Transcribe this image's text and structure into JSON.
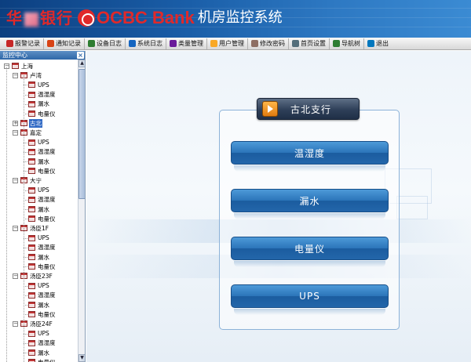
{
  "header": {
    "brand_cn": "华 银行",
    "brand_en": "OCBC Bank",
    "title": "机房监控系统"
  },
  "toolbar": {
    "items": [
      {
        "label": "报警记录",
        "icon": "alarm-icon",
        "color": "#c62828"
      },
      {
        "label": "通知记录",
        "icon": "notify-icon",
        "color": "#d84315"
      },
      {
        "label": "设备日志",
        "icon": "device-log-icon",
        "color": "#2e7d32"
      },
      {
        "label": "系统日志",
        "icon": "system-log-icon",
        "color": "#1565c0"
      },
      {
        "label": "类量管理",
        "icon": "settings-icon",
        "color": "#6a1b9a"
      },
      {
        "label": "用户管理",
        "icon": "user-icon",
        "color": "#f9a825"
      },
      {
        "label": "修改密码",
        "icon": "key-icon",
        "color": "#8d6e63"
      },
      {
        "label": "首页设置",
        "icon": "tools-icon",
        "color": "#546e7a"
      },
      {
        "label": "导航树",
        "icon": "tree-icon",
        "color": "#2e7d32"
      },
      {
        "label": "退出",
        "icon": "exit-icon",
        "color": "#0277bd"
      }
    ]
  },
  "sidebar": {
    "title": "监控中心",
    "close": "×",
    "tree": [
      {
        "label": "上海",
        "level": 0,
        "expander": "−"
      },
      {
        "label": "卢湾",
        "level": 1,
        "expander": "−"
      },
      {
        "label": "UPS",
        "level": 2
      },
      {
        "label": "温湿度",
        "level": 2
      },
      {
        "label": "漏水",
        "level": 2
      },
      {
        "label": "电量仪",
        "level": 2
      },
      {
        "label": "古北",
        "level": 1,
        "expander": "+",
        "selected": true
      },
      {
        "label": "嘉定",
        "level": 1,
        "expander": "−"
      },
      {
        "label": "UPS",
        "level": 2
      },
      {
        "label": "温湿度",
        "level": 2
      },
      {
        "label": "漏水",
        "level": 2
      },
      {
        "label": "电量仪",
        "level": 2
      },
      {
        "label": "大宁",
        "level": 1,
        "expander": "−"
      },
      {
        "label": "UPS",
        "level": 2
      },
      {
        "label": "温湿度",
        "level": 2
      },
      {
        "label": "漏水",
        "level": 2
      },
      {
        "label": "电量仪",
        "level": 2
      },
      {
        "label": "汤臣1F",
        "level": 1,
        "expander": "−"
      },
      {
        "label": "UPS",
        "level": 2
      },
      {
        "label": "温湿度",
        "level": 2
      },
      {
        "label": "漏水",
        "level": 2
      },
      {
        "label": "电量仪",
        "level": 2
      },
      {
        "label": "汤臣23F",
        "level": 1,
        "expander": "−"
      },
      {
        "label": "UPS",
        "level": 2
      },
      {
        "label": "温湿度",
        "level": 2
      },
      {
        "label": "漏水",
        "level": 2
      },
      {
        "label": "电量仪",
        "level": 2
      },
      {
        "label": "汤臣24F",
        "level": 1,
        "expander": "−"
      },
      {
        "label": "UPS",
        "level": 2
      },
      {
        "label": "温湿度",
        "level": 2
      },
      {
        "label": "漏水",
        "level": 2
      },
      {
        "label": "电量仪",
        "level": 2
      }
    ]
  },
  "main": {
    "panel_title": "古北支行",
    "buttons": [
      {
        "label": "温湿度"
      },
      {
        "label": "漏水"
      },
      {
        "label": "电量仪"
      },
      {
        "label": "UPS"
      }
    ]
  },
  "colors": {
    "header_bg": "#1a5ea8",
    "brand_red": "#e0292a",
    "button_blue": "#2b74b9",
    "selected_bg": "#316ac5"
  }
}
